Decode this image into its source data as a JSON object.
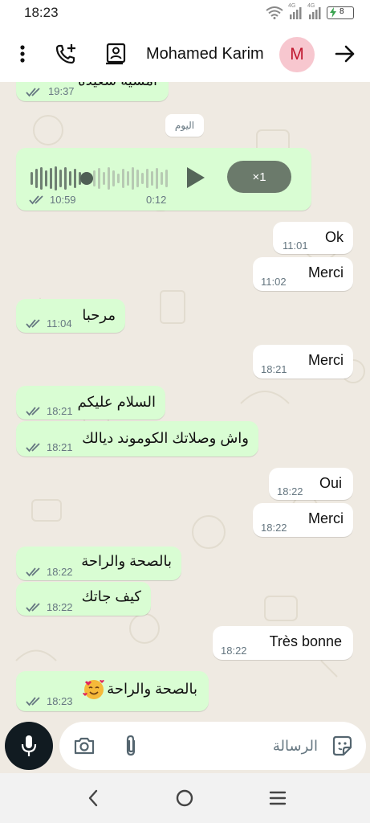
{
  "status_bar": {
    "time": "18:23",
    "network_label_1": "4G",
    "network_label_2": "4G",
    "battery": "8"
  },
  "header": {
    "contact_name": "Mohamed Karim",
    "avatar_initial": "M"
  },
  "chat": {
    "date_separator": "اليوم",
    "messages": [
      {
        "dir": "in",
        "text": "امسية سعيدة",
        "time": "19:37"
      },
      {
        "dir": "in",
        "type": "voice",
        "time": "10:59",
        "duration": "0:12",
        "playback_speed": "×1"
      },
      {
        "dir": "out",
        "text": "Ok",
        "time": "11:01"
      },
      {
        "dir": "out",
        "text": "Merci",
        "time": "11:02"
      },
      {
        "dir": "in",
        "text": "مرحبا",
        "time": "11:04"
      },
      {
        "dir": "out",
        "text": "Merci",
        "time": "18:21"
      },
      {
        "dir": "in",
        "text": "السلام عليكم",
        "time": "18:21"
      },
      {
        "dir": "in",
        "text": "واش وصلاتك الكوموند ديالك",
        "time": "18:21"
      },
      {
        "dir": "out",
        "text": "Oui",
        "time": "18:22"
      },
      {
        "dir": "out",
        "text": "Merci",
        "time": "18:22"
      },
      {
        "dir": "in",
        "text": "بالصحة والراحة",
        "time": "18:22"
      },
      {
        "dir": "in",
        "text": "كيف جاتك",
        "time": "18:22"
      },
      {
        "dir": "out",
        "text": "Très bonne",
        "time": "18:22"
      },
      {
        "dir": "in",
        "text": "بالصحة والراحة",
        "time": "18:23",
        "emoji": "smiling-face-with-hearts"
      }
    ]
  },
  "composer": {
    "placeholder": "الرسالة"
  },
  "colors": {
    "incoming_bubble": "#d9fdd3",
    "outgoing_bubble": "#ffffff",
    "wallpaper": "#efeae2",
    "mic_button": "#111b21",
    "read_ticks": "#667781",
    "avatar_bg": "#f7c7cf",
    "avatar_fg": "#c0182f"
  }
}
